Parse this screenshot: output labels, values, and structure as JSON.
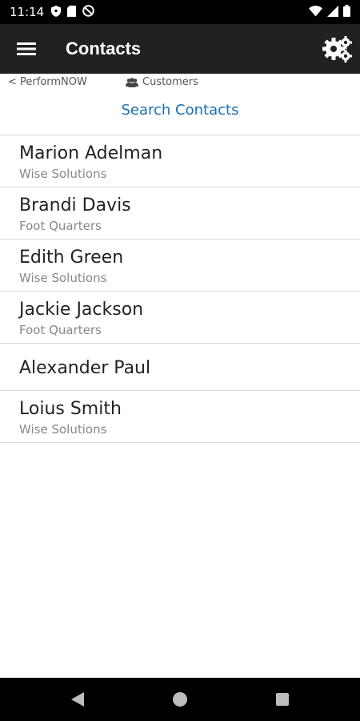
{
  "status_bar": {
    "time": "11:14",
    "left_icons": [
      "shield-icon",
      "sd-card-icon",
      "do-not-disturb-icon"
    ],
    "right_icons": [
      "wifi-icon",
      "cellular-signal-icon",
      "battery-icon"
    ]
  },
  "app_bar": {
    "title": "Contacts",
    "menu_icon": "hamburger-menu-icon",
    "settings_icon": "gears-icon"
  },
  "nav": {
    "back_label": "< PerformNOW",
    "customers_label": "Customers",
    "customers_icon": "users-icon"
  },
  "search_label": "Search Contacts",
  "contacts": [
    {
      "name": "Marion Adelman",
      "company": "Wise Solutions"
    },
    {
      "name": "Brandi Davis",
      "company": "Foot Quarters"
    },
    {
      "name": "Edith Green",
      "company": "Wise Solutions"
    },
    {
      "name": "Jackie Jackson",
      "company": "Foot Quarters"
    },
    {
      "name": "Alexander Paul",
      "company": ""
    },
    {
      "name": "Loius Smith",
      "company": "Wise Solutions"
    }
  ],
  "system_nav": [
    "back-triangle-icon",
    "home-circle-icon",
    "recents-square-icon"
  ],
  "colors": {
    "status_bar_bg": "#000000",
    "app_bar_bg": "#212121",
    "link_blue": "#1a6fb0",
    "divider": "#d9d9d9"
  }
}
